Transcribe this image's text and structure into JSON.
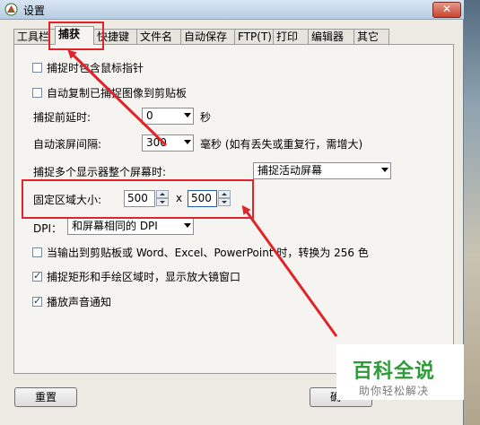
{
  "window": {
    "title": "设置"
  },
  "tabs": [
    {
      "label": "工具栏"
    },
    {
      "label": "捕获"
    },
    {
      "label": "快捷键"
    },
    {
      "label": "文件名"
    },
    {
      "label": "自动保存"
    },
    {
      "label": "FTP(T)"
    },
    {
      "label": "打印"
    },
    {
      "label": "编辑器"
    },
    {
      "label": "其它"
    }
  ],
  "active_tab": "捕获",
  "options": {
    "include_cursor": {
      "label": "捕捉时包含鼠标指针",
      "checked": false
    },
    "auto_copy": {
      "label": "自动复制已捕捉图像到剪贴板",
      "checked": false
    },
    "capture_delay": {
      "label": "捕捉前延时:",
      "value": "0",
      "unit": "秒"
    },
    "scroll_interval": {
      "label": "自动滚屏间隔:",
      "value": "300",
      "unit": "毫秒 (如有丢失或重复行，需增大)"
    },
    "multi_monitor": {
      "label": "捕捉多个显示器整个屏幕时:",
      "value": "捕捉活动屏幕"
    },
    "fixed_region": {
      "label": "固定区域大小:",
      "width": "500",
      "x": "x",
      "height": "500"
    },
    "dpi": {
      "label": "DPI：",
      "value": "和屏幕相同的 DPI"
    },
    "convert_256": {
      "label": "当输出到剪贴板或 Word、Excel、PowerPoint 时，转换为 256 色",
      "checked": false
    },
    "magnifier": {
      "label": "捕捉矩形和手绘区域时，显示放大镜窗口",
      "checked": true
    },
    "sound": {
      "label": "播放声音通知",
      "checked": true
    }
  },
  "buttons": {
    "reset": "重置",
    "ok_partial": "确"
  },
  "watermark": {
    "main": "百科全说",
    "sub": "助你轻松解决"
  },
  "colors": {
    "highlight": "#e0242a",
    "watermark_green": "#2f9a3a"
  }
}
